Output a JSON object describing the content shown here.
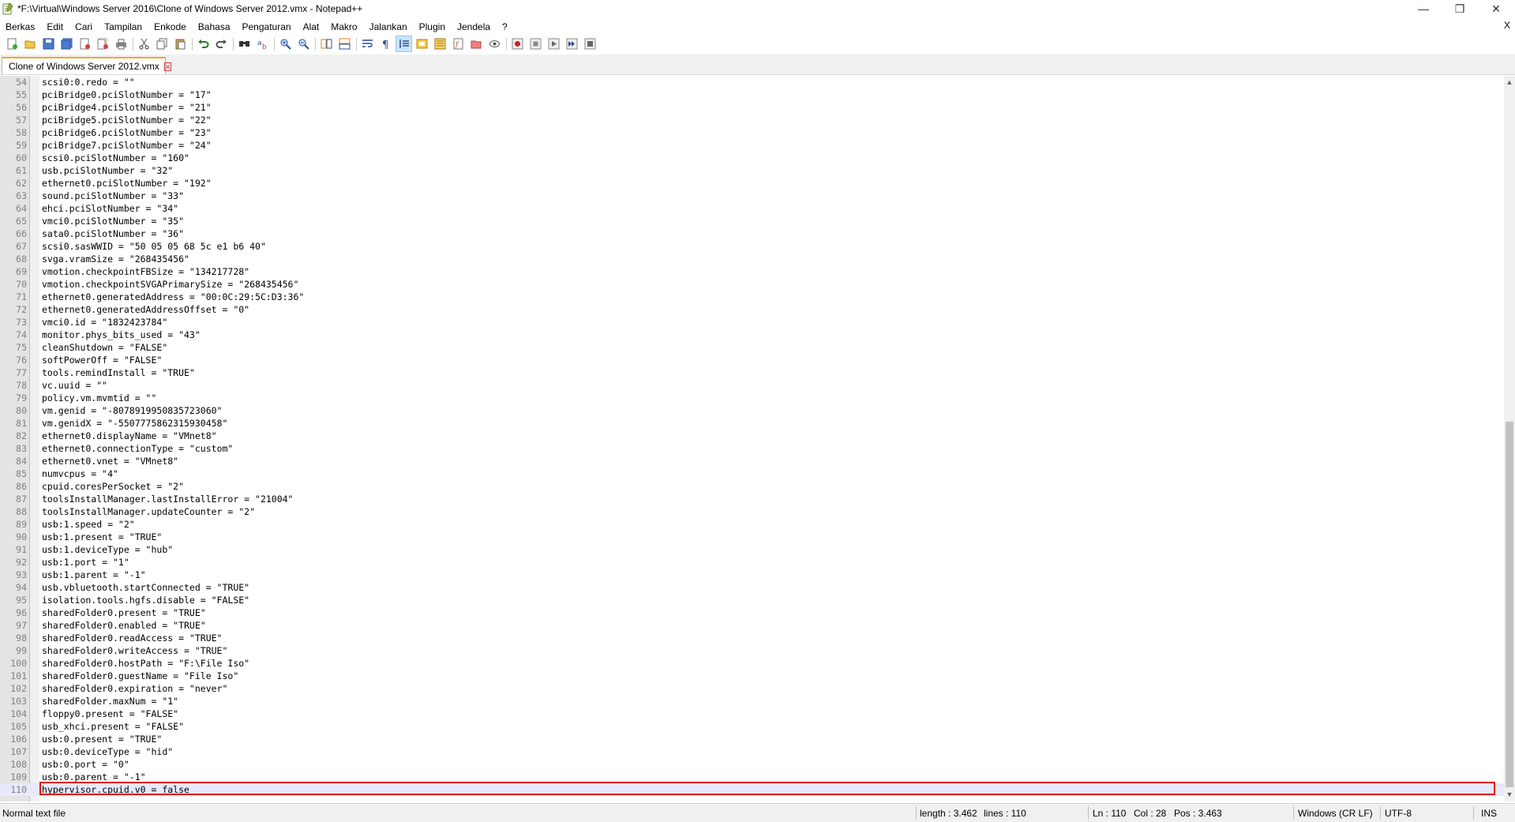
{
  "window": {
    "title": "*F:\\Virtual\\Windows Server 2016\\Clone of Windows Server 2012.vmx - Notepad++",
    "minimize": "—",
    "maximize": "❐",
    "close": "✕"
  },
  "menu": {
    "items": [
      "Berkas",
      "Edit",
      "Cari",
      "Tampilan",
      "Enkode",
      "Bahasa",
      "Pengaturan",
      "Alat",
      "Makro",
      "Jalankan",
      "Plugin",
      "Jendela",
      "?"
    ],
    "close": "X"
  },
  "toolbar": {
    "icons": [
      "new-file-icon",
      "open-file-icon",
      "save-icon",
      "save-all-icon",
      "close-icon",
      "close-all-icon",
      "print-icon",
      "cut-icon",
      "copy-icon",
      "paste-icon",
      "undo-icon",
      "redo-icon",
      "find-icon",
      "replace-icon",
      "zoom-in-icon",
      "zoom-out-icon",
      "sync-vertical-icon",
      "sync-horizontal-icon",
      "word-wrap-icon",
      "show-all-characters-icon",
      "indent-guide-icon",
      "user-language-icon",
      "document-map-icon",
      "function-list-icon",
      "folder-workspace-icon",
      "monitoring-icon",
      "record-macro-icon",
      "stop-record-icon",
      "play-macro-icon",
      "play-macro-multiple-icon",
      "save-macro-icon"
    ]
  },
  "tab": {
    "label": "Clone of Windows Server 2012.vmx",
    "close": "✕"
  },
  "editor": {
    "lines": [
      {
        "n": "54",
        "text": "scsi0:0.redo = \"\""
      },
      {
        "n": "55",
        "text": "pciBridge0.pciSlotNumber = \"17\""
      },
      {
        "n": "56",
        "text": "pciBridge4.pciSlotNumber = \"21\""
      },
      {
        "n": "57",
        "text": "pciBridge5.pciSlotNumber = \"22\""
      },
      {
        "n": "58",
        "text": "pciBridge6.pciSlotNumber = \"23\""
      },
      {
        "n": "59",
        "text": "pciBridge7.pciSlotNumber = \"24\""
      },
      {
        "n": "60",
        "text": "scsi0.pciSlotNumber = \"160\""
      },
      {
        "n": "61",
        "text": "usb.pciSlotNumber = \"32\""
      },
      {
        "n": "62",
        "text": "ethernet0.pciSlotNumber = \"192\""
      },
      {
        "n": "63",
        "text": "sound.pciSlotNumber = \"33\""
      },
      {
        "n": "64",
        "text": "ehci.pciSlotNumber = \"34\""
      },
      {
        "n": "65",
        "text": "vmci0.pciSlotNumber = \"35\""
      },
      {
        "n": "66",
        "text": "sata0.pciSlotNumber = \"36\""
      },
      {
        "n": "67",
        "text": "scsi0.sasWWID = \"50 05 05 68 5c e1 b6 40\""
      },
      {
        "n": "68",
        "text": "svga.vramSize = \"268435456\""
      },
      {
        "n": "69",
        "text": "vmotion.checkpointFBSize = \"134217728\""
      },
      {
        "n": "70",
        "text": "vmotion.checkpointSVGAPrimarySize = \"268435456\""
      },
      {
        "n": "71",
        "text": "ethernet0.generatedAddress = \"00:0C:29:5C:D3:36\""
      },
      {
        "n": "72",
        "text": "ethernet0.generatedAddressOffset = \"0\""
      },
      {
        "n": "73",
        "text": "vmci0.id = \"1832423784\""
      },
      {
        "n": "74",
        "text": "monitor.phys_bits_used = \"43\""
      },
      {
        "n": "75",
        "text": "cleanShutdown = \"FALSE\""
      },
      {
        "n": "76",
        "text": "softPowerOff = \"FALSE\""
      },
      {
        "n": "77",
        "text": "tools.remindInstall = \"TRUE\""
      },
      {
        "n": "78",
        "text": "vc.uuid = \"\""
      },
      {
        "n": "79",
        "text": "policy.vm.mvmtid = \"\""
      },
      {
        "n": "80",
        "text": "vm.genid = \"-8078919950835723060\""
      },
      {
        "n": "81",
        "text": "vm.genidX = \"-5507775862315930458\""
      },
      {
        "n": "82",
        "text": "ethernet0.displayName = \"VMnet8\""
      },
      {
        "n": "83",
        "text": "ethernet0.connectionType = \"custom\""
      },
      {
        "n": "84",
        "text": "ethernet0.vnet = \"VMnet8\""
      },
      {
        "n": "85",
        "text": "numvcpus = \"4\""
      },
      {
        "n": "86",
        "text": "cpuid.coresPerSocket = \"2\""
      },
      {
        "n": "87",
        "text": "toolsInstallManager.lastInstallError = \"21004\""
      },
      {
        "n": "88",
        "text": "toolsInstallManager.updateCounter = \"2\""
      },
      {
        "n": "89",
        "text": "usb:1.speed = \"2\""
      },
      {
        "n": "90",
        "text": "usb:1.present = \"TRUE\""
      },
      {
        "n": "91",
        "text": "usb:1.deviceType = \"hub\""
      },
      {
        "n": "92",
        "text": "usb:1.port = \"1\""
      },
      {
        "n": "93",
        "text": "usb:1.parent = \"-1\""
      },
      {
        "n": "94",
        "text": "usb.vbluetooth.startConnected = \"TRUE\""
      },
      {
        "n": "95",
        "text": "isolation.tools.hgfs.disable = \"FALSE\""
      },
      {
        "n": "96",
        "text": "sharedFolder0.present = \"TRUE\""
      },
      {
        "n": "97",
        "text": "sharedFolder0.enabled = \"TRUE\""
      },
      {
        "n": "98",
        "text": "sharedFolder0.readAccess = \"TRUE\""
      },
      {
        "n": "99",
        "text": "sharedFolder0.writeAccess = \"TRUE\""
      },
      {
        "n": "100",
        "text": "sharedFolder0.hostPath = \"F:\\File Iso\""
      },
      {
        "n": "101",
        "text": "sharedFolder0.guestName = \"File Iso\""
      },
      {
        "n": "102",
        "text": "sharedFolder0.expiration = \"never\""
      },
      {
        "n": "103",
        "text": "sharedFolder.maxNum = \"1\""
      },
      {
        "n": "104",
        "text": "floppy0.present = \"FALSE\""
      },
      {
        "n": "105",
        "text": "usb_xhci.present = \"FALSE\""
      },
      {
        "n": "106",
        "text": "usb:0.present = \"TRUE\""
      },
      {
        "n": "107",
        "text": "usb:0.deviceType = \"hid\""
      },
      {
        "n": "108",
        "text": "usb:0.port = \"0\""
      },
      {
        "n": "109",
        "text": "usb:0.parent = \"-1\""
      },
      {
        "n": "110",
        "text": "hypervisor.cpuid.v0 = false"
      }
    ],
    "current_line": "110"
  },
  "status": {
    "file_type": "Normal text file",
    "length": "length : 3.462",
    "lines": "lines : 110",
    "ln": "Ln : 110",
    "col": "Col : 28",
    "pos": "Pos : 3.463",
    "eol": "Windows (CR LF)",
    "encoding": "UTF-8",
    "mode": "INS"
  },
  "colors": {
    "highlight_border": "#e01010",
    "current_line_bg": "#e8e8ff",
    "tab_accent": "#f5a623"
  }
}
